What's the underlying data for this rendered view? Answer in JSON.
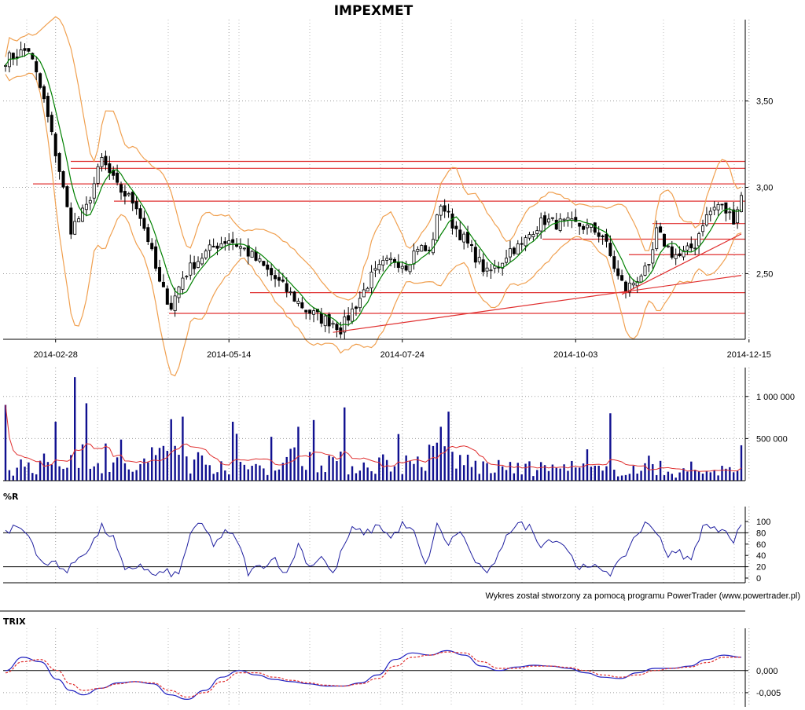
{
  "title": "IMPEXMET",
  "credit": "Wykres został stworzony za pomocą programu PowerTrader (www.powertrader.pl)",
  "colors": {
    "candle_up": "#ffffff",
    "candle_down": "#000000",
    "moving_average": "#008000",
    "bollinger": "#f0a050",
    "support_lines": "#e03030",
    "volume_bars": "#101090",
    "volume_average": "#e03030",
    "williams_r": "#2020a0",
    "trix": "#2020c0",
    "trix_signal": "#e03030"
  },
  "chart_data": [
    {
      "type": "candlestick",
      "title": "IMPEXMET",
      "x_tick_labels": [
        "2014-02-28",
        "2014-05-14",
        "2014-07-24",
        "2014-10-03",
        "2014-12-15"
      ],
      "y_tick_labels": [
        "3,50",
        "3,00",
        "2,50"
      ],
      "ylim": [
        2.12,
        3.88
      ],
      "grid": true,
      "close_path": [
        [
          0,
          3.74
        ],
        [
          6,
          3.8
        ],
        [
          10,
          3.5
        ],
        [
          14,
          3.1
        ],
        [
          17,
          2.76
        ],
        [
          21,
          2.88
        ],
        [
          25,
          3.16
        ],
        [
          29,
          3.0
        ],
        [
          34,
          2.9
        ],
        [
          37,
          2.7
        ],
        [
          40,
          2.44
        ],
        [
          43,
          2.31
        ],
        [
          46,
          2.48
        ],
        [
          49,
          2.56
        ],
        [
          52,
          2.62
        ],
        [
          55,
          2.67
        ],
        [
          58,
          2.7
        ],
        [
          62,
          2.64
        ],
        [
          66,
          2.56
        ],
        [
          70,
          2.47
        ],
        [
          74,
          2.38
        ],
        [
          78,
          2.29
        ],
        [
          82,
          2.24
        ],
        [
          85,
          2.22
        ],
        [
          87,
          2.18
        ],
        [
          89,
          2.25
        ],
        [
          92,
          2.36
        ],
        [
          95,
          2.48
        ],
        [
          98,
          2.55
        ],
        [
          101,
          2.58
        ],
        [
          104,
          2.55
        ],
        [
          107,
          2.66
        ],
        [
          110,
          2.62
        ],
        [
          113,
          2.91
        ],
        [
          116,
          2.79
        ],
        [
          119,
          2.7
        ],
        [
          122,
          2.6
        ],
        [
          125,
          2.5
        ],
        [
          128,
          2.55
        ],
        [
          131,
          2.64
        ],
        [
          134,
          2.66
        ],
        [
          137,
          2.76
        ],
        [
          140,
          2.81
        ],
        [
          143,
          2.79
        ],
        [
          146,
          2.79
        ],
        [
          149,
          2.78
        ],
        [
          152,
          2.76
        ],
        [
          155,
          2.72
        ],
        [
          157,
          2.6
        ],
        [
          159,
          2.48
        ],
        [
          161,
          2.41
        ],
        [
          163,
          2.45
        ],
        [
          165,
          2.5
        ],
        [
          167,
          2.52
        ],
        [
          169,
          2.74
        ],
        [
          171,
          2.68
        ],
        [
          173,
          2.62
        ],
        [
          175,
          2.6
        ],
        [
          177,
          2.63
        ],
        [
          179,
          2.67
        ],
        [
          181,
          2.8
        ],
        [
          183,
          2.86
        ],
        [
          185,
          2.9
        ],
        [
          187,
          2.86
        ],
        [
          189,
          2.82
        ],
        [
          191,
          2.95
        ]
      ],
      "horizontal_levels": [
        3.15,
        3.11,
        3.02,
        2.92,
        2.79,
        2.7,
        2.61,
        2.39,
        2.27
      ],
      "trendlines": [
        {
          "from": [
            85,
            2.16
          ],
          "to": [
            191,
            2.49
          ]
        },
        {
          "from": [
            160,
            2.38
          ],
          "to": [
            191,
            2.73
          ]
        }
      ]
    },
    {
      "type": "bar",
      "title": "",
      "y_tick_labels": [
        "1 000 000",
        "500 000"
      ],
      "ylim": [
        0,
        1250000
      ],
      "volume_profile": [
        [
          0,
          180000
        ],
        [
          10,
          220000
        ],
        [
          17,
          280000
        ],
        [
          21,
          420000
        ],
        [
          26,
          220000
        ],
        [
          34,
          160000
        ],
        [
          40,
          300000
        ],
        [
          44,
          450000
        ],
        [
          48,
          260000
        ],
        [
          55,
          240000
        ],
        [
          62,
          180000
        ],
        [
          70,
          220000
        ],
        [
          76,
          320000
        ],
        [
          83,
          300000
        ],
        [
          90,
          190000
        ],
        [
          98,
          240000
        ],
        [
          106,
          220000
        ],
        [
          113,
          360000
        ],
        [
          118,
          260000
        ],
        [
          124,
          180000
        ],
        [
          132,
          150000
        ],
        [
          140,
          160000
        ],
        [
          148,
          170000
        ],
        [
          156,
          120000
        ],
        [
          160,
          160000
        ],
        [
          166,
          150000
        ],
        [
          172,
          100000
        ],
        [
          180,
          120000
        ],
        [
          186,
          140000
        ],
        [
          191,
          150000
        ]
      ],
      "volume_peaks": [
        [
          0,
          900000
        ],
        [
          13,
          700000
        ],
        [
          18,
          1230000
        ],
        [
          43,
          730000
        ],
        [
          46,
          760000
        ],
        [
          59,
          700000
        ],
        [
          76,
          640000
        ],
        [
          80,
          720000
        ],
        [
          88,
          870000
        ],
        [
          113,
          640000
        ],
        [
          115,
          820000
        ],
        [
          157,
          800000
        ],
        [
          191,
          420000
        ]
      ]
    },
    {
      "type": "line",
      "title": "%R",
      "y_tick_labels": [
        "100",
        "80",
        "60",
        "40",
        "20",
        "0"
      ],
      "ylim": [
        0,
        100
      ],
      "reference_lines": [
        80,
        20
      ],
      "williams_r": [
        [
          0,
          80
        ],
        [
          3,
          92
        ],
        [
          6,
          75
        ],
        [
          10,
          20
        ],
        [
          13,
          30
        ],
        [
          16,
          10
        ],
        [
          19,
          38
        ],
        [
          22,
          55
        ],
        [
          25,
          90
        ],
        [
          28,
          70
        ],
        [
          31,
          10
        ],
        [
          35,
          25
        ],
        [
          38,
          5
        ],
        [
          42,
          10
        ],
        [
          45,
          5
        ],
        [
          48,
          80
        ],
        [
          51,
          95
        ],
        [
          54,
          60
        ],
        [
          57,
          80
        ],
        [
          60,
          70
        ],
        [
          63,
          10
        ],
        [
          66,
          20
        ],
        [
          70,
          35
        ],
        [
          73,
          5
        ],
        [
          76,
          60
        ],
        [
          79,
          20
        ],
        [
          82,
          40
        ],
        [
          85,
          5
        ],
        [
          88,
          60
        ],
        [
          90,
          85
        ],
        [
          94,
          80
        ],
        [
          97,
          95
        ],
        [
          100,
          70
        ],
        [
          103,
          95
        ],
        [
          106,
          80
        ],
        [
          109,
          20
        ],
        [
          112,
          92
        ],
        [
          115,
          60
        ],
        [
          118,
          85
        ],
        [
          121,
          40
        ],
        [
          124,
          10
        ],
        [
          127,
          20
        ],
        [
          130,
          80
        ],
        [
          133,
          95
        ],
        [
          136,
          90
        ],
        [
          139,
          60
        ],
        [
          142,
          70
        ],
        [
          145,
          60
        ],
        [
          148,
          25
        ],
        [
          151,
          15
        ],
        [
          154,
          20
        ],
        [
          157,
          10
        ],
        [
          160,
          30
        ],
        [
          163,
          70
        ],
        [
          166,
          95
        ],
        [
          169,
          85
        ],
        [
          172,
          40
        ],
        [
          175,
          45
        ],
        [
          178,
          30
        ],
        [
          181,
          95
        ],
        [
          184,
          85
        ],
        [
          187,
          90
        ],
        [
          189,
          60
        ],
        [
          191,
          100
        ]
      ]
    },
    {
      "type": "line",
      "title": "TRIX",
      "y_tick_labels": [
        "0,000",
        "-0,005"
      ],
      "ylim": [
        -0.0075,
        0.006
      ],
      "trix": [
        [
          0,
          0.0
        ],
        [
          4,
          0.003
        ],
        [
          8,
          0.002
        ],
        [
          12,
          -0.002
        ],
        [
          15,
          -0.0045
        ],
        [
          18,
          -0.0055
        ],
        [
          22,
          -0.004
        ],
        [
          26,
          -0.0028
        ],
        [
          30,
          -0.0025
        ],
        [
          34,
          -0.003
        ],
        [
          38,
          -0.0055
        ],
        [
          42,
          -0.0065
        ],
        [
          46,
          -0.0045
        ],
        [
          50,
          -0.0015
        ],
        [
          54,
          0.0
        ],
        [
          58,
          -0.001
        ],
        [
          62,
          -0.002
        ],
        [
          66,
          -0.0025
        ],
        [
          70,
          -0.003
        ],
        [
          74,
          -0.0035
        ],
        [
          78,
          -0.0035
        ],
        [
          82,
          -0.0028
        ],
        [
          86,
          -0.001
        ],
        [
          90,
          0.0025
        ],
        [
          94,
          0.004
        ],
        [
          98,
          0.0035
        ],
        [
          102,
          0.0045
        ],
        [
          106,
          0.0035
        ],
        [
          110,
          0.001
        ],
        [
          114,
          0.0
        ],
        [
          118,
          0.0008
        ],
        [
          122,
          0.0012
        ],
        [
          126,
          0.001
        ],
        [
          130,
          0.0005
        ],
        [
          134,
          -0.0005
        ],
        [
          138,
          -0.0015
        ],
        [
          142,
          -0.0018
        ],
        [
          146,
          -0.0005
        ],
        [
          150,
          0.0005
        ],
        [
          154,
          0.0005
        ],
        [
          158,
          0.001
        ],
        [
          162,
          0.0025
        ],
        [
          166,
          0.0035
        ],
        [
          170,
          0.003
        ]
      ],
      "signal": [
        [
          0,
          -0.0005
        ],
        [
          4,
          0.002
        ],
        [
          8,
          0.0025
        ],
        [
          12,
          0.0
        ],
        [
          15,
          -0.003
        ],
        [
          18,
          -0.0045
        ],
        [
          22,
          -0.004
        ],
        [
          26,
          -0.003
        ],
        [
          30,
          -0.0025
        ],
        [
          34,
          -0.0028
        ],
        [
          38,
          -0.0045
        ],
        [
          42,
          -0.006
        ],
        [
          46,
          -0.005
        ],
        [
          50,
          -0.0025
        ],
        [
          54,
          -0.0005
        ],
        [
          58,
          -0.0005
        ],
        [
          62,
          -0.0015
        ],
        [
          66,
          -0.0022
        ],
        [
          70,
          -0.0028
        ],
        [
          74,
          -0.0033
        ],
        [
          78,
          -0.0035
        ],
        [
          82,
          -0.003
        ],
        [
          86,
          -0.0018
        ],
        [
          90,
          0.001
        ],
        [
          94,
          0.003
        ],
        [
          98,
          0.0035
        ],
        [
          102,
          0.0042
        ],
        [
          106,
          0.004
        ],
        [
          110,
          0.002
        ],
        [
          114,
          0.0005
        ],
        [
          118,
          0.0005
        ],
        [
          122,
          0.001
        ],
        [
          126,
          0.001
        ],
        [
          130,
          0.0007
        ],
        [
          134,
          0.0
        ],
        [
          138,
          -0.001
        ],
        [
          142,
          -0.0015
        ],
        [
          146,
          -0.001
        ],
        [
          150,
          0.0
        ],
        [
          154,
          0.0005
        ],
        [
          158,
          0.0008
        ],
        [
          162,
          0.0018
        ],
        [
          166,
          0.003
        ],
        [
          170,
          0.003
        ]
      ]
    }
  ]
}
